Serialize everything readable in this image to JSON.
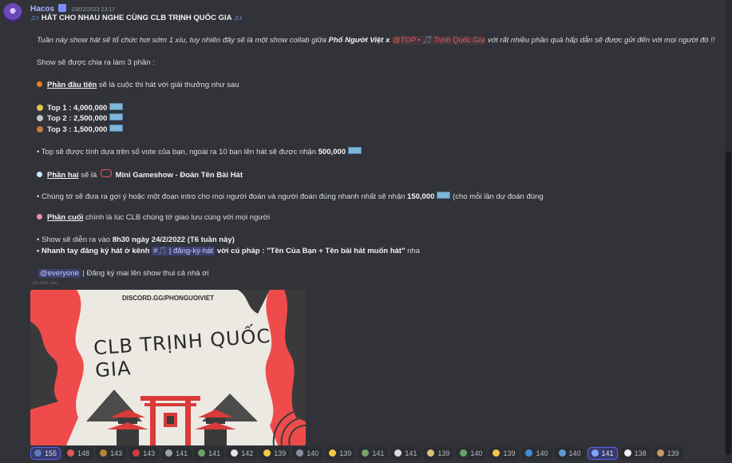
{
  "header": {
    "author": "Hacos",
    "timestamp": "23/02/2023 23:17"
  },
  "message": {
    "title": "HÁT CHO NHAU NGHE CÙNG CLB TRỊNH QUỐC GIA",
    "intro": {
      "before": "Tuần này show hát sẽ tổ chức hơi sớm 1 xíu, tuy nhiên đây sẽ là một show collab giữa ",
      "bold": "Phố Người Việt x",
      "mention": "@TOP • 🎵 Trịnh Quốc Gia",
      "after": " với rất nhiều phần quà hấp dẫn sẽ được gửi đến với mọi người đó !!"
    },
    "parts_intro": "Show sẽ được chia ra làm 3 phần :",
    "part1": {
      "label": "Phần đầu tiên",
      "text": " sẽ là cuộc thi hát với giải thưởng như sau"
    },
    "prizes": [
      {
        "label": "Top 1  : 4,000,000"
      },
      {
        "label": "Top 2  : 2,500,000"
      },
      {
        "label": "Top 3 : 1,500,000"
      }
    ],
    "vote_line": {
      "text": "• Top sẽ được tính dựa trên số vote của bạn, ngoài ra 10 bạn lên hát sẽ được nhận ",
      "amount": "500,000"
    },
    "part2": {
      "label": "Phần hai",
      "text": " sẽ là ",
      "game": "Mini Gameshow - Đoán Tên Bài Hát"
    },
    "intro_line": {
      "text": "• Chúng tớ sẽ đưa ra gợi ý hoặc một đoạn intro cho mọi người đoán và người đoán đúng nhanh nhất sẽ nhận ",
      "amount": "150,000",
      "after": "  (cho mỗi lần dự đoán đúng"
    },
    "part3": {
      "label": "Phần cuối",
      "text": " chính là lúc CLB chúng tớ giao lưu cùng với mọi người"
    },
    "schedule": {
      "text": "• Show sẽ diễn ra vào ",
      "bold": "8h30 ngày 24/2/2022 (T6 tuần này)"
    },
    "signup": {
      "bold": "• Nhanh tay đăng ký hát ở kênh ",
      "channel": "#🎵 | đăng-ký-hát",
      "bold2": " với cú pháp : \"Tên Của Bạn + Tên bài hát muốn hát\"",
      "after": " nha"
    },
    "everyone": {
      "mention": "@everyone",
      "text": " | Đăng ký mai lên show thui cả nhà ơi"
    },
    "edited": "(đã chỉnh sửa)"
  },
  "image": {
    "url_text": "DISCORD.GG/PHONGUOIVIET",
    "banner_title": "CLB TRỊNH QUỐC GIA",
    "colors": {
      "red": "#ef4b4b",
      "dark": "#3a3a3a",
      "paper": "#ece9e3"
    }
  },
  "reactions": [
    {
      "icon": "flag-icon",
      "count": "155",
      "me": true,
      "color": "#5a7bbd"
    },
    {
      "icon": "heart-icon",
      "count": "148",
      "me": false,
      "color": "#e05a5a"
    },
    {
      "icon": "flag-icon",
      "count": "143",
      "me": false,
      "color": "#b5863c"
    },
    {
      "icon": "maple-leaf-icon",
      "count": "143",
      "me": false,
      "color": "#d63c3c"
    },
    {
      "icon": "wave-icon",
      "count": "141",
      "me": false,
      "color": "#9aa0a6"
    },
    {
      "icon": "image-icon",
      "count": "141",
      "me": false,
      "color": "#6aa36a"
    },
    {
      "icon": "skull-icon",
      "count": "142",
      "me": false,
      "color": "#e6e6e6"
    },
    {
      "icon": "face-icon",
      "count": "139",
      "me": false,
      "color": "#f2c744"
    },
    {
      "icon": "image-icon",
      "count": "140",
      "me": false,
      "color": "#8a8fa0"
    },
    {
      "icon": "hand-icon",
      "count": "139",
      "me": false,
      "color": "#f2c744"
    },
    {
      "icon": "image-icon",
      "count": "141",
      "me": false,
      "color": "#7aa06a"
    },
    {
      "icon": "bottle-icon",
      "count": "141",
      "me": false,
      "color": "#dcdcdc"
    },
    {
      "icon": "wand-icon",
      "count": "139",
      "me": false,
      "color": "#d9c27a"
    },
    {
      "icon": "image-icon",
      "count": "140",
      "me": false,
      "color": "#6aa36a"
    },
    {
      "icon": "face-icon",
      "count": "139",
      "me": false,
      "color": "#f2c744"
    },
    {
      "icon": "s-icon",
      "count": "140",
      "me": false,
      "color": "#3a8fd8"
    },
    {
      "icon": "arrow-down-icon",
      "count": "140",
      "me": false,
      "color": "#5b9bd5"
    },
    {
      "icon": "notes-icon",
      "count": "141",
      "me": true,
      "color": "#7da4ff"
    },
    {
      "icon": "bowl-icon",
      "count": "138",
      "me": false,
      "color": "#f0f0f0"
    },
    {
      "icon": "monkey-icon",
      "count": "139",
      "me": false,
      "color": "#c79a62"
    }
  ]
}
